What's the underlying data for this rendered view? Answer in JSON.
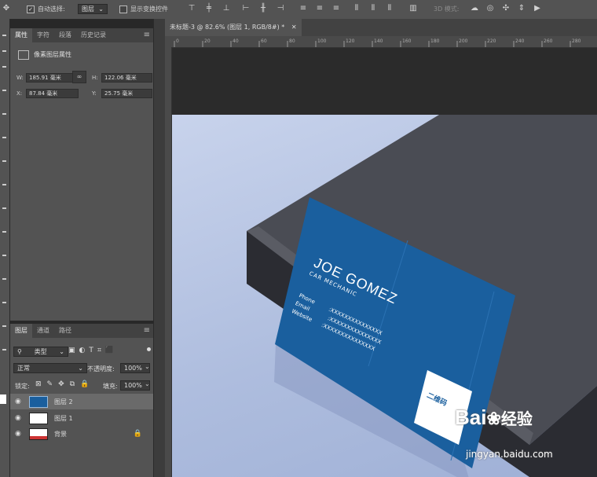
{
  "options_bar": {
    "auto_select_label": "自动选择:",
    "auto_select_value": "图层",
    "show_transform_label": "显示变换控件",
    "mode_3d_label": "3D 模式:"
  },
  "properties_panel": {
    "tabs": [
      "属性",
      "字符",
      "段落",
      "历史记录"
    ],
    "section_title": "像素图层属性",
    "w_label": "W:",
    "w_value": "185.91 毫米",
    "h_label": "H:",
    "h_value": "122.06 毫米",
    "x_label": "X:",
    "x_value": "87.84 毫米",
    "y_label": "Y:",
    "y_value": "25.75 毫米"
  },
  "document": {
    "tab_title": "未标题-3 @ 82.6% (图层 1, RGB/8#) *",
    "ruler_ticks": [
      "0",
      "20",
      "40",
      "60",
      "80",
      "100",
      "120",
      "140",
      "160",
      "180",
      "200",
      "220",
      "240",
      "260",
      "280"
    ]
  },
  "business_card": {
    "name": "JOE GOMEZ",
    "title": "CAR MECHANIC",
    "fields": [
      {
        "label": "Phone",
        "value": ""
      },
      {
        "label": "Email",
        "value": ":XXXXXXXXXXXXXXX"
      },
      {
        "label": "Website",
        "value": ":XXXXXXXXXXXXXXX"
      }
    ],
    "phone_value": ":XXXXXXXXXXXXXXX",
    "qr_label": "二维码",
    "card_color": "#1a5f9e"
  },
  "layers_panel": {
    "tabs": [
      "图层",
      "通道",
      "路径"
    ],
    "filter_label": "类型",
    "blend_mode": "正常",
    "opacity_label": "不透明度:",
    "opacity_value": "100%",
    "lock_label": "锁定:",
    "fill_label": "填充:",
    "fill_value": "100%",
    "layers": [
      {
        "name": "图层 2",
        "selected": true
      },
      {
        "name": "图层 1",
        "selected": false
      },
      {
        "name": "背景",
        "selected": false
      }
    ]
  },
  "watermark": {
    "brand": "Bai",
    "brand_cn": "经验",
    "url": "jingyan.baidu.com"
  },
  "colors": {
    "panel_bg": "#535353",
    "app_bg": "#282828",
    "accent_selected": "#6a6a6a"
  }
}
